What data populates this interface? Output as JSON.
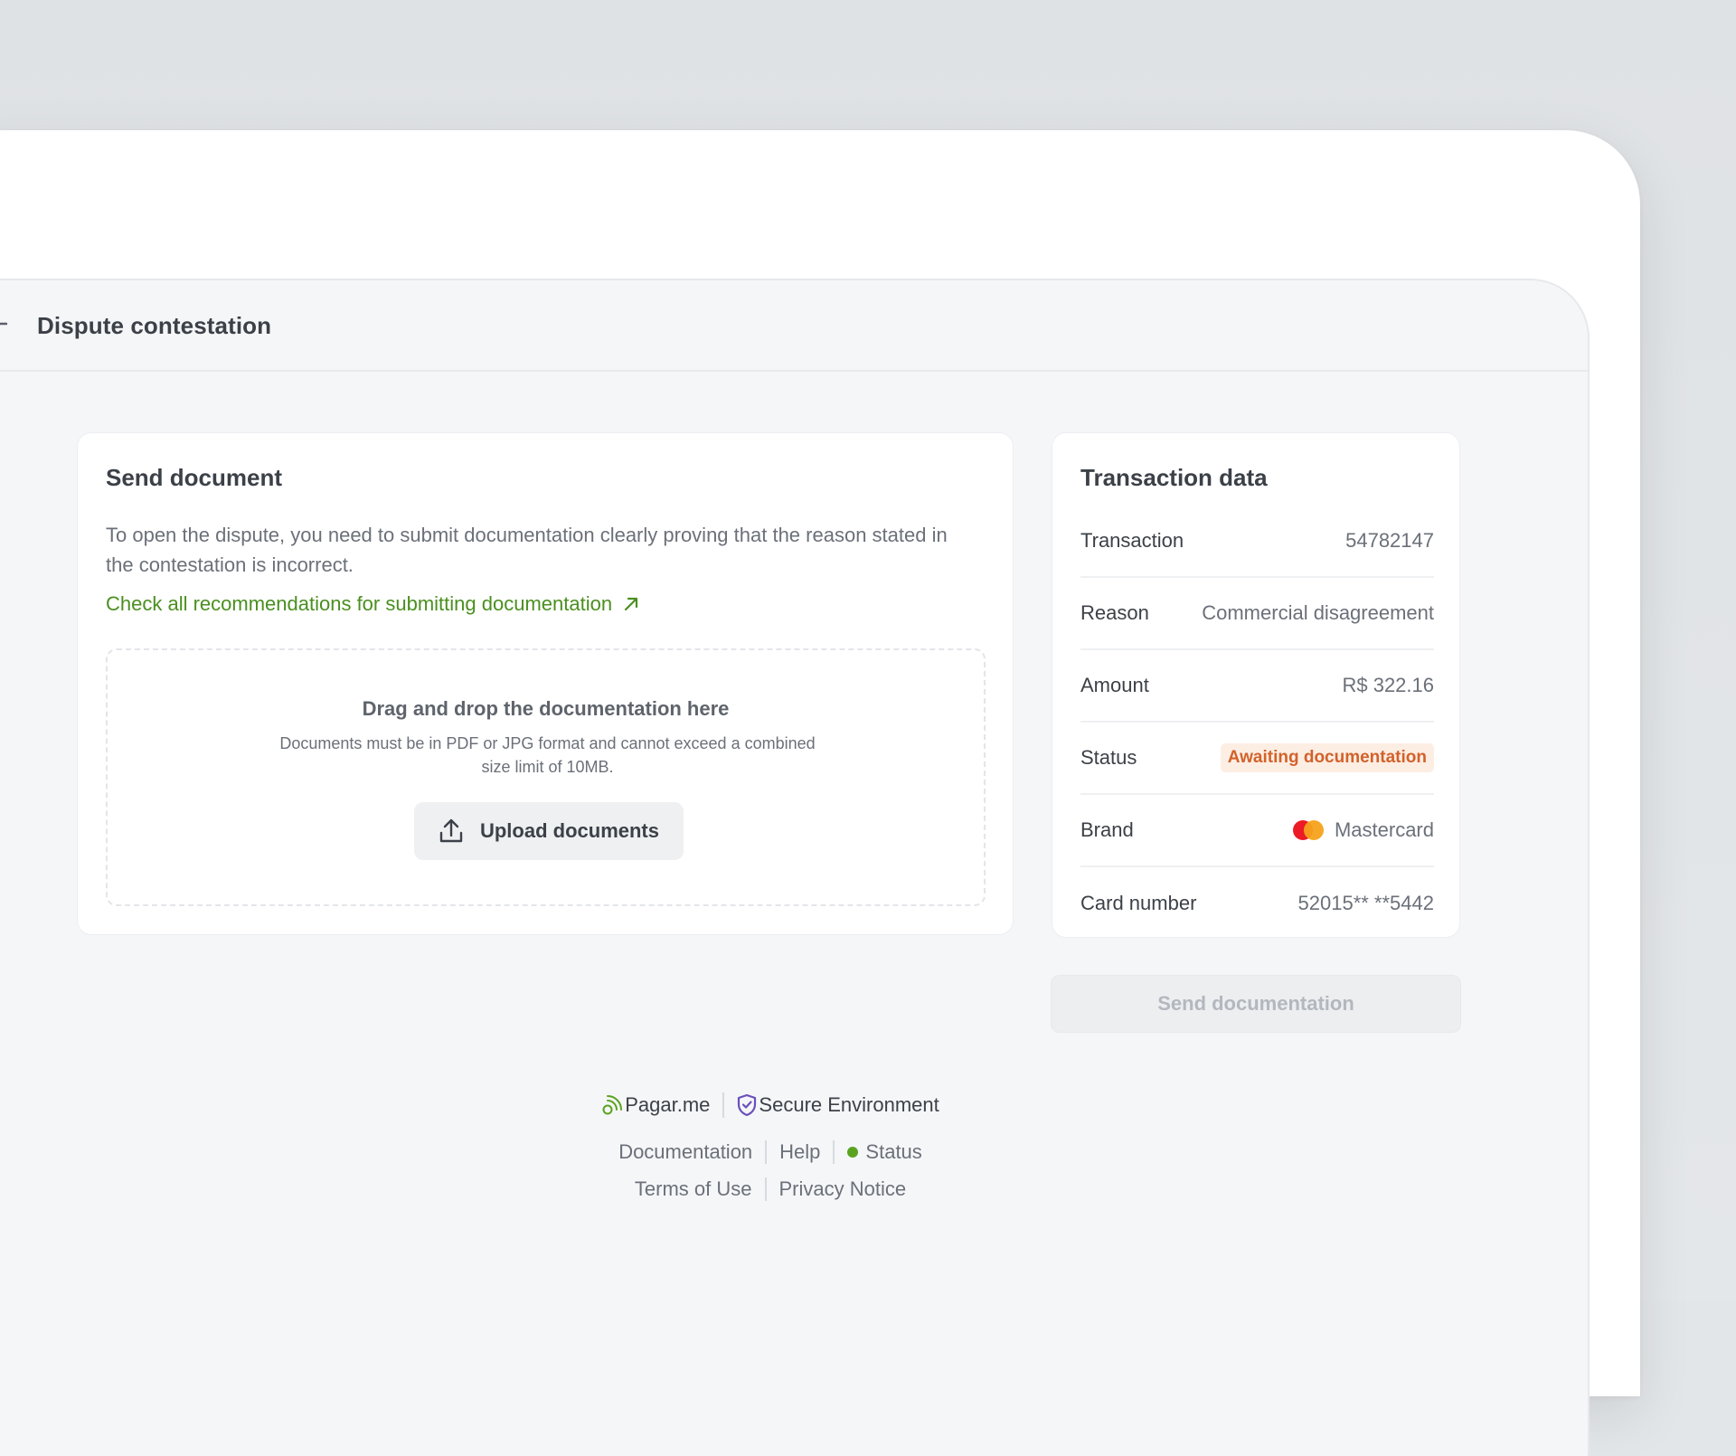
{
  "header": {
    "title": "Dispute contestation",
    "back_icon": "arrow-left-icon"
  },
  "send_document": {
    "title": "Send document",
    "description": "To open the dispute, you need to submit documentation clearly proving that the reason stated in the contestation is incorrect.",
    "link_label": "Check all recommendations for submitting documentation",
    "link_icon": "arrow-up-right-icon",
    "dropzone": {
      "title": "Drag and drop the documentation here",
      "subtitle": "Documents must be in PDF or JPG format and cannot exceed a combined size limit of 10MB.",
      "upload_label": "Upload documents",
      "upload_icon": "upload-icon"
    }
  },
  "transaction_data": {
    "title": "Transaction data",
    "rows": [
      {
        "label": "Transaction",
        "value": "54782147"
      },
      {
        "label": "Reason",
        "value": "Commercial disagreement"
      },
      {
        "label": "Amount",
        "value": "R$ 322.16"
      },
      {
        "label": "Status",
        "value": "Awaiting documentation"
      },
      {
        "label": "Brand",
        "value": "Mastercard"
      },
      {
        "label": "Card number",
        "value": "52015** **5442"
      }
    ]
  },
  "send_button": {
    "label": "Send documentation"
  },
  "footer": {
    "brand": "Pagar.me",
    "secure": "Secure Environment",
    "links": {
      "documentation": "Documentation",
      "help": "Help",
      "status": "Status",
      "terms": "Terms of Use",
      "privacy": "Privacy Notice"
    }
  },
  "colors": {
    "accent_green": "#4a8f1f",
    "status_orange": "#d2622a",
    "status_bg": "#fdeee4",
    "shield_purple": "#6b4fbb"
  }
}
